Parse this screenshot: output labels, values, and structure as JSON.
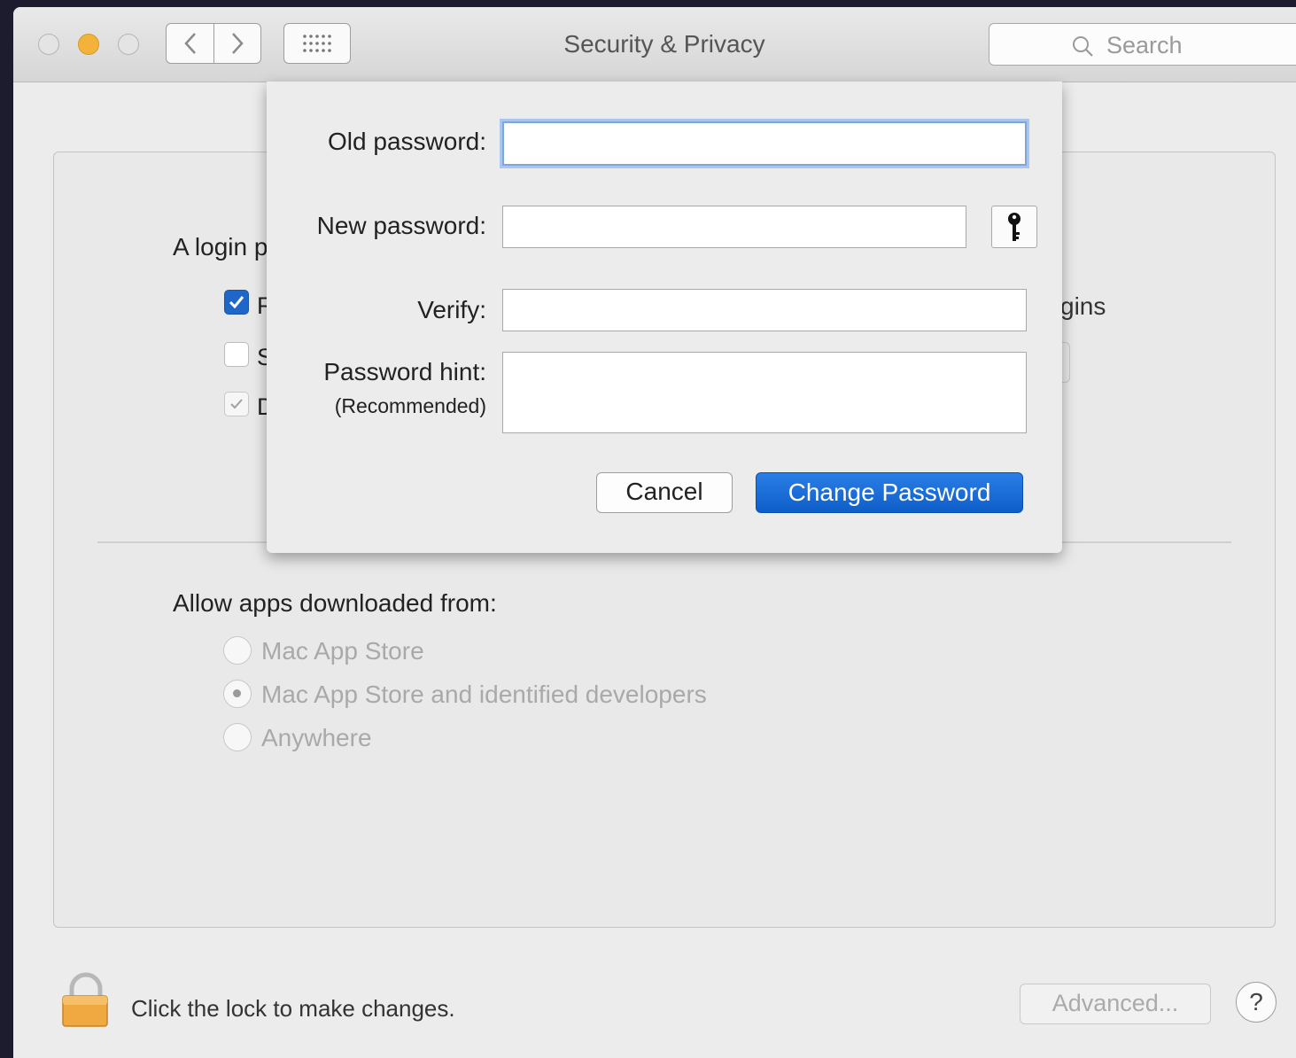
{
  "window": {
    "title": "Security & Privacy",
    "search_placeholder": "Search"
  },
  "general": {
    "login_label": "A login p",
    "checkbox_labels": [
      "R",
      "S",
      "D"
    ],
    "checkbox_states": [
      true,
      false,
      true
    ],
    "partial_right_text": "gins"
  },
  "gatekeeper": {
    "label": "Allow apps downloaded from:",
    "options": [
      "Mac App Store",
      "Mac App Store and identified developers",
      "Anywhere"
    ],
    "selected": "Mac App Store and identified developers"
  },
  "footer": {
    "lock_text": "Click the lock to make changes.",
    "advanced_label": "Advanced...",
    "help_label": "?"
  },
  "sheet": {
    "old_password_label": "Old password:",
    "new_password_label": "New password:",
    "verify_label": "Verify:",
    "hint_label": "Password hint:",
    "hint_sublabel": "(Recommended)",
    "old_password_value": "",
    "new_password_value": "",
    "verify_value": "",
    "hint_value": "",
    "cancel_label": "Cancel",
    "change_label": "Change Password"
  },
  "icons": {
    "search": "search-icon",
    "back": "chevron-left-icon",
    "forward": "chevron-right-icon",
    "grid": "grid-icon",
    "key": "key-icon",
    "lock": "lock-icon",
    "check": "checkmark-icon"
  },
  "colors": {
    "accent": "#1e66c8",
    "minimize": "#f3b33a",
    "lock": "#f0a840"
  }
}
